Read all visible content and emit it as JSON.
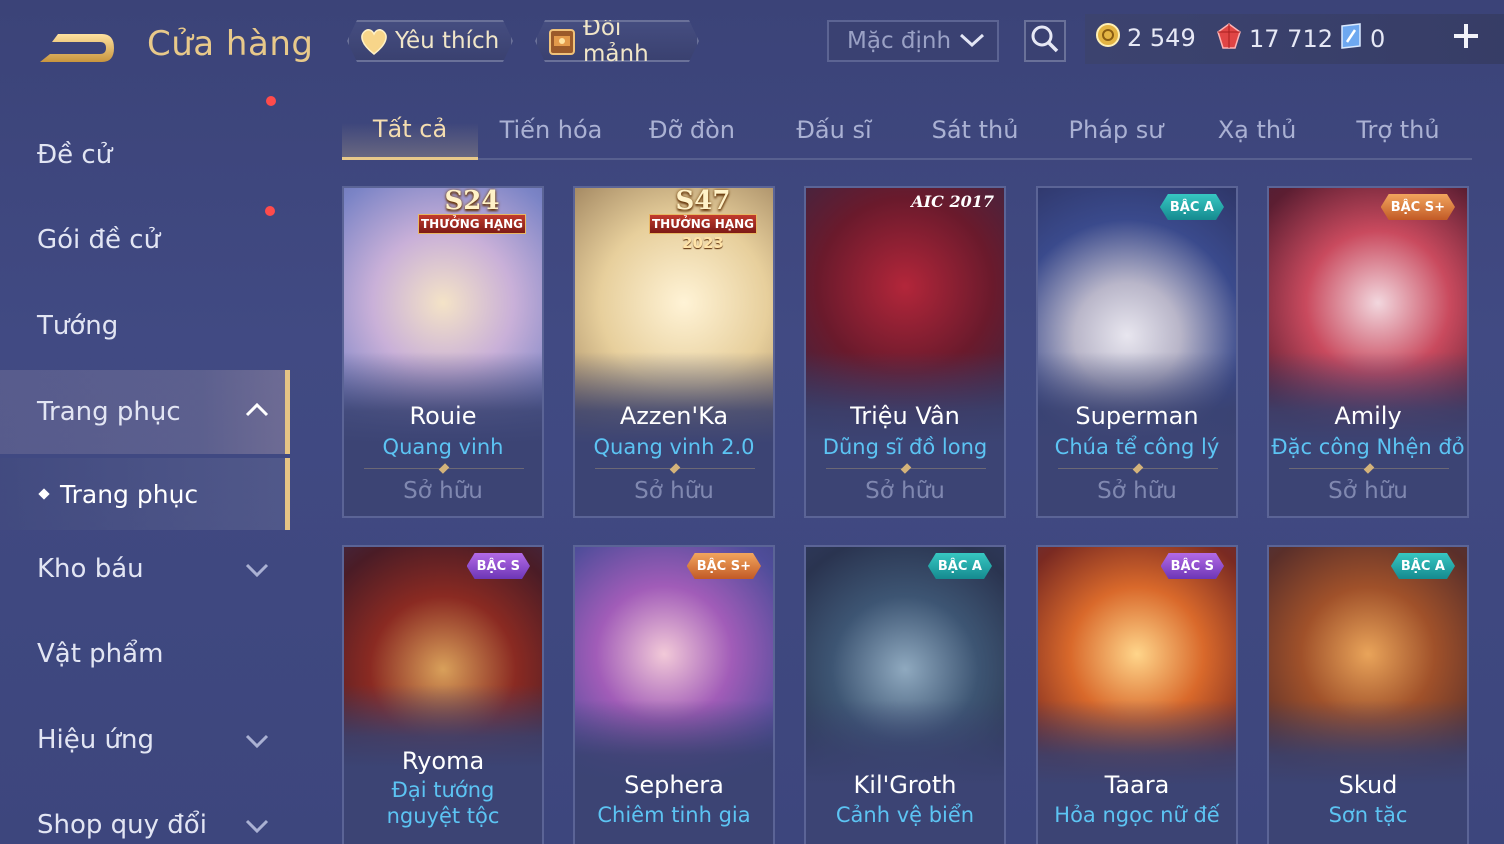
{
  "header": {
    "title": "Cửa hàng",
    "favorites_label": "Yêu thích",
    "exchange_label": "Đổi mảnh",
    "sort_value": "Mặc định",
    "currencies": [
      {
        "name": "gold",
        "icon": "coin-icon",
        "value": "2 549",
        "color": "#e3b443"
      },
      {
        "name": "ruby",
        "icon": "ruby-icon",
        "value": "17 712",
        "color": "#e04545"
      },
      {
        "name": "crystal",
        "icon": "crystal-icon",
        "value": "0",
        "color": "#8fc3ff"
      }
    ]
  },
  "sidebar": {
    "items": [
      {
        "label": "Đề cử"
      },
      {
        "label": "Gói đề cử"
      },
      {
        "label": "Tướng"
      },
      {
        "label": "Trang phục"
      },
      {
        "label": "Trang phục"
      },
      {
        "label": "Kho báu"
      },
      {
        "label": "Vật phẩm"
      },
      {
        "label": "Hiệu ứng"
      },
      {
        "label": "Shop quy đổi"
      }
    ]
  },
  "tabs": [
    "Tất cả",
    "Tiến hóa",
    "Đỡ đòn",
    "Đấu sĩ",
    "Sát thủ",
    "Pháp sư",
    "Xạ thủ",
    "Trợ thủ"
  ],
  "cards": [
    {
      "hero": "Rouie",
      "skin": "Quang vinh",
      "status": "Sở hữu",
      "badge": "",
      "rank_big": "S24",
      "rank_label": "THƯỞNG HẠNG",
      "rank_year": ""
    },
    {
      "hero": "Azzen'Ka",
      "skin": "Quang vinh 2.0",
      "status": "Sở hữu",
      "badge": "",
      "rank_big": "S47",
      "rank_label": "THƯỞNG HẠNG",
      "rank_year": "2023"
    },
    {
      "hero": "Triệu Vân",
      "skin": "Dũng sĩ đồ long",
      "status": "Sở hữu",
      "badge": "AIC 2017"
    },
    {
      "hero": "Superman",
      "skin": "Chúa tể công lý",
      "status": "Sở hữu",
      "badge": "BẬC A"
    },
    {
      "hero": "Amily",
      "skin": "Đặc công Nhện đỏ",
      "status": "Sở hữu",
      "badge": "BẬC S+"
    },
    {
      "hero": "Ryoma",
      "skin": "Đại tướng nguyệt tộc",
      "badge": "BẬC S"
    },
    {
      "hero": "Sephera",
      "skin": "Chiêm tinh gia",
      "badge": "BẬC S+"
    },
    {
      "hero": "Kil'Groth",
      "skin": "Cảnh vệ biển",
      "badge": "BẬC A"
    },
    {
      "hero": "Taara",
      "skin": "Hỏa ngọc nữ đế",
      "badge": "BẬC S"
    },
    {
      "hero": "Skud",
      "skin": "Sơn tặc",
      "badge": "BẬC A"
    }
  ]
}
